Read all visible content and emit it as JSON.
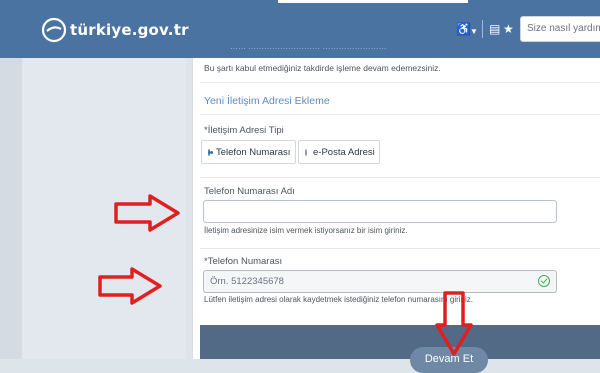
{
  "header": {
    "logo_text": "türkiye.gov.tr",
    "search_placeholder": "Size nasıl yardım e"
  },
  "form": {
    "clipped_text": "…… ……………………… ……………………",
    "terms_note": "Bu şartı kabul etmediğiniz takdirde işleme devam edemezsiniz.",
    "section_title": "Yeni İletişim Adresi Ekleme",
    "type_label": "*İletişim Adresi Tipi",
    "option_phone": "Telefon Numarası",
    "option_email": "e-Posta Adresi",
    "name_label": "Telefon Numarası Adı",
    "name_value": "",
    "name_helper": "İletişim adresinize isim vermek istiyorsanız bir isim giriniz.",
    "phone_label": "*Telefon Numarası",
    "phone_value": "Örn. 5122345678",
    "phone_helper": "Lütfen iletişim adresi olarak kaydetmek istediğiniz telefon numarasını giriniz.",
    "next_button": "Devam Et"
  },
  "colors": {
    "header_bg": "#4a73a2",
    "accent": "#5d8bc0",
    "arrow_red": "#e02020",
    "valid_green": "#3fae55"
  }
}
